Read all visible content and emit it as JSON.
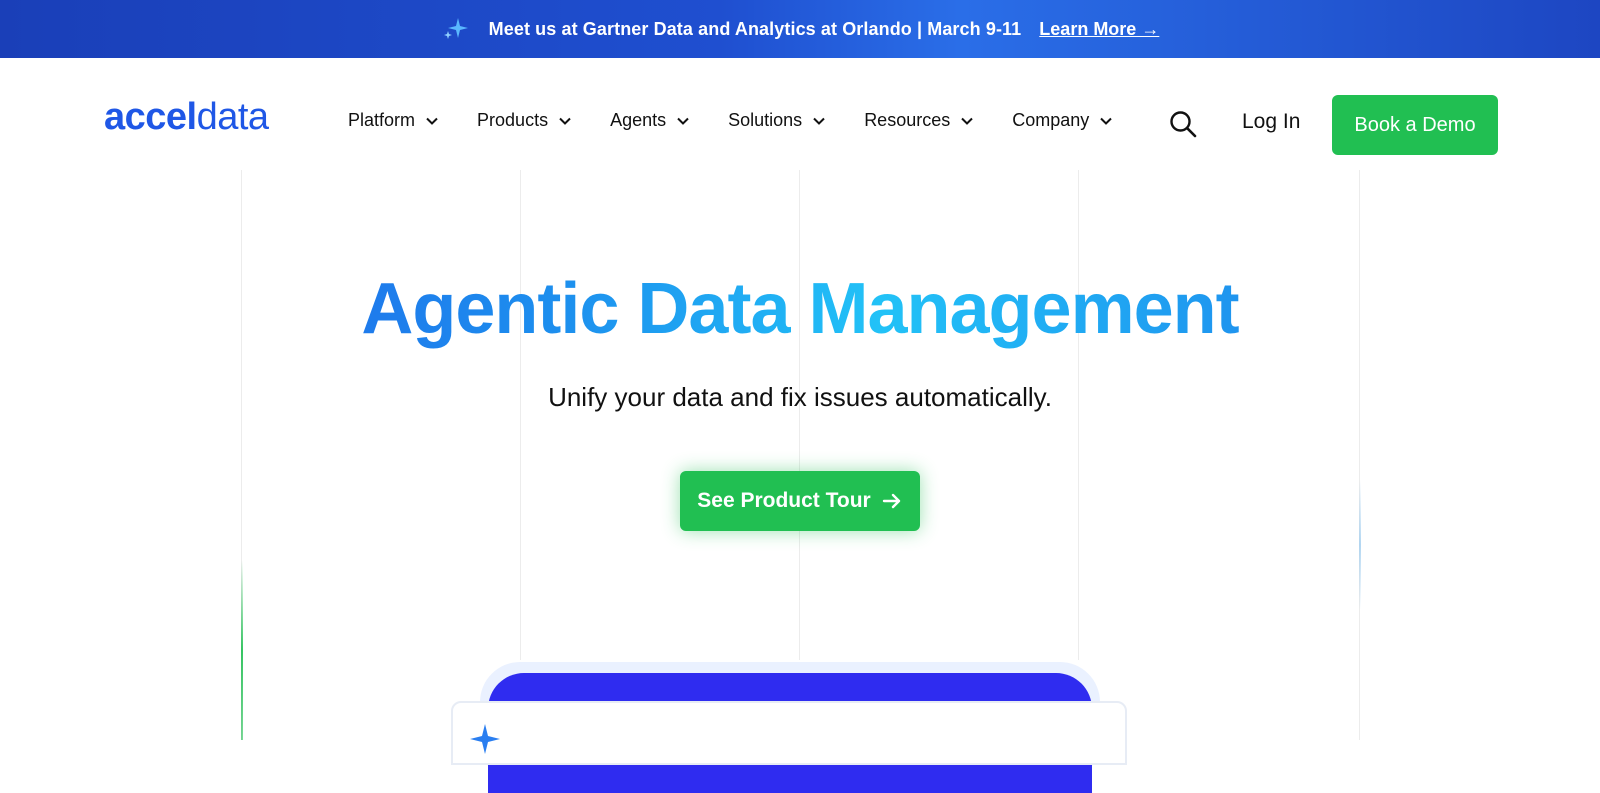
{
  "announcement": {
    "icon": "sparkle-icon",
    "text": "Meet us at Gartner Data and Analytics at Orlando | March 9-11",
    "link_label": "Learn More →"
  },
  "nav": {
    "logo_part1": "accel",
    "logo_part2": "data",
    "menu": [
      {
        "label": "Platform"
      },
      {
        "label": "Products"
      },
      {
        "label": "Agents"
      },
      {
        "label": "Solutions"
      },
      {
        "label": "Resources"
      },
      {
        "label": "Company"
      }
    ],
    "search_icon": "search-icon",
    "login_label": "Log In",
    "demo_label": "Book a Demo"
  },
  "hero": {
    "title": "Agentic Data Management",
    "subtitle": "Unify your data and fix issues automatically.",
    "cta_label": "See Product Tour"
  },
  "colors": {
    "accent_green": "#21bf52",
    "brand_blue": "#1f57e6",
    "bar_blue": "#1f4fd0",
    "card_indigo": "#2f2cf0"
  }
}
